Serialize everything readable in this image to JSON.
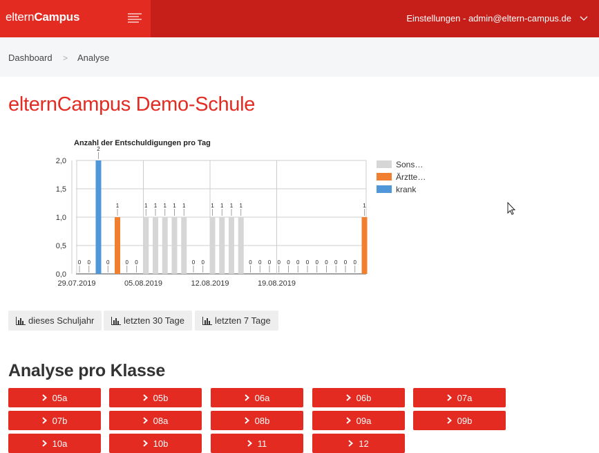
{
  "header": {
    "brand_part1": "eltern",
    "brand_part2": "Campus",
    "user_menu": "Einstellungen - admin@eltern-campus.de"
  },
  "breadcrumb": {
    "items": [
      "Dashboard",
      "Analyse"
    ],
    "separator": ">"
  },
  "page_title": "elternCampus Demo-Schule",
  "chart_data": {
    "type": "bar",
    "stacked": true,
    "title": "Anzahl der Entschuldigungen pro Tag",
    "ylim": [
      0,
      2
    ],
    "yticks": [
      "0,0",
      "0,5",
      "1,0",
      "1,5",
      "2,0"
    ],
    "xtick_labels": [
      "29.07.2019",
      "05.08.2019",
      "12.08.2019",
      "19.08.2019"
    ],
    "legend_position": "right",
    "legend": [
      "Sons…",
      "Ärztte…",
      "krank"
    ],
    "categories": [
      "2019-07-29",
      "2019-07-30",
      "2019-07-31",
      "2019-08-01",
      "2019-08-02",
      "2019-08-03",
      "2019-08-04",
      "2019-08-05",
      "2019-08-06",
      "2019-08-07",
      "2019-08-08",
      "2019-08-09",
      "2019-08-10",
      "2019-08-11",
      "2019-08-12",
      "2019-08-13",
      "2019-08-14",
      "2019-08-15",
      "2019-08-16",
      "2019-08-17",
      "2019-08-18",
      "2019-08-19",
      "2019-08-20",
      "2019-08-21",
      "2019-08-22",
      "2019-08-23",
      "2019-08-24",
      "2019-08-25",
      "2019-08-26",
      "2019-08-27",
      "2019-08-28"
    ],
    "series": [
      {
        "name": "Sons…",
        "color": "#d6d6d6",
        "values": [
          0,
          0,
          0,
          0,
          0,
          0,
          0,
          1,
          1,
          1,
          1,
          1,
          0,
          0,
          1,
          1,
          1,
          1,
          0,
          0,
          0,
          0,
          0,
          0,
          0,
          0,
          0,
          0,
          0,
          0,
          0
        ]
      },
      {
        "name": "Ärztte…",
        "color": "#f07f30",
        "values": [
          0,
          0,
          0,
          0,
          1,
          0,
          0,
          0,
          0,
          0,
          0,
          0,
          0,
          0,
          0,
          0,
          0,
          0,
          0,
          0,
          0,
          0,
          0,
          0,
          0,
          0,
          0,
          0,
          0,
          0,
          1
        ]
      },
      {
        "name": "krank",
        "color": "#4f97d8",
        "values": [
          0,
          0,
          2,
          0,
          0,
          0,
          0,
          0,
          0,
          0,
          0,
          0,
          0,
          0,
          0,
          0,
          0,
          0,
          0,
          0,
          0,
          0,
          0,
          0,
          0,
          0,
          0,
          0,
          0,
          0,
          0
        ]
      }
    ],
    "totals": [
      0,
      0,
      2,
      0,
      1,
      0,
      0,
      1,
      1,
      1,
      1,
      1,
      0,
      0,
      1,
      1,
      1,
      1,
      0,
      0,
      0,
      0,
      0,
      0,
      0,
      0,
      0,
      0,
      0,
      0,
      1
    ]
  },
  "range_buttons": [
    {
      "label": "dieses Schuljahr"
    },
    {
      "label": "letzten 30 Tage"
    },
    {
      "label": "letzten 7 Tage"
    }
  ],
  "section_title": "Analyse pro Klasse",
  "classes": [
    "05a",
    "05b",
    "06a",
    "06b",
    "07a",
    "07b",
    "08a",
    "08b",
    "09a",
    "09b",
    "10a",
    "10b",
    "11",
    "12"
  ],
  "colors": {
    "header_dark": "#c61f1a",
    "brand": "#e32b22",
    "accent": "#e32b22"
  }
}
